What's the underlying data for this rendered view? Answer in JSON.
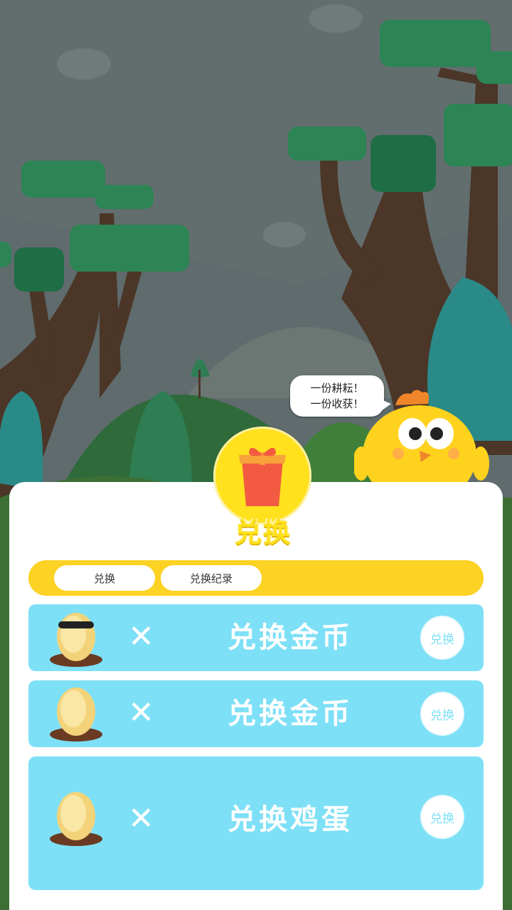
{
  "speech": {
    "line1": "一份耕耘！",
    "line2": "一份收获！"
  },
  "panel": {
    "title": "兑换"
  },
  "tabs": [
    {
      "label": "兑换",
      "active": true
    },
    {
      "label": "兑换纪录",
      "active": false
    }
  ],
  "items": [
    {
      "label": "兑换金币",
      "button": "兑换",
      "egg": "sunglasses-egg-icon"
    },
    {
      "label": "兑换金币",
      "button": "兑换",
      "egg": "egg-icon"
    },
    {
      "label": "兑换鸡蛋",
      "button": "兑换",
      "egg": "egg-icon"
    }
  ],
  "colors": {
    "accent_yellow": "#fcd224",
    "row_blue": "#7ee0f6",
    "sky": "#5d6a6c"
  }
}
